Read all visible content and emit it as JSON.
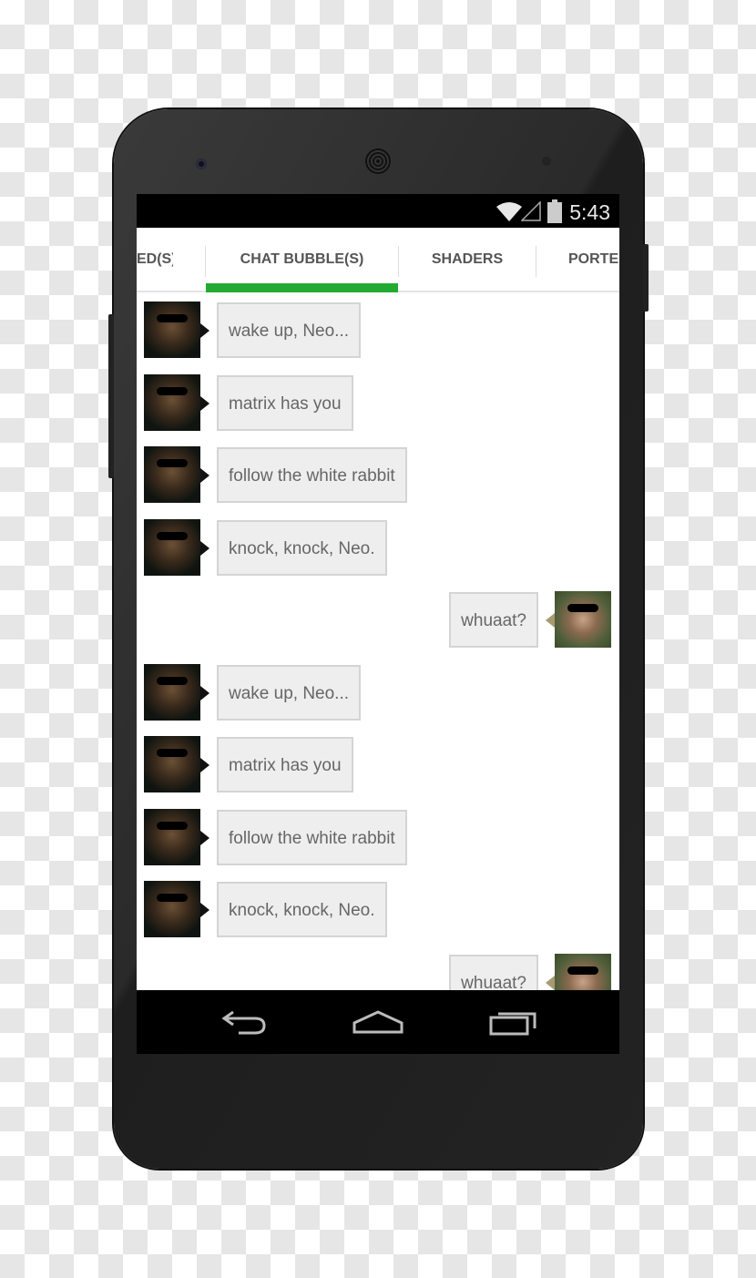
{
  "status": {
    "time": "5:43",
    "icons": [
      "wifi-icon",
      "signal-icon",
      "battery-icon"
    ]
  },
  "tabs": [
    {
      "label": "ED(S)"
    },
    {
      "label": "CHAT BUBBLE(S)",
      "active": true
    },
    {
      "label": "SHADERS"
    },
    {
      "label": "PORTE"
    }
  ],
  "accent": "#22aa33",
  "messages": [
    {
      "text": "wake up, Neo...",
      "side": "left",
      "sender": "morpheus"
    },
    {
      "text": "matrix has you",
      "side": "left",
      "sender": "morpheus"
    },
    {
      "text": "follow the white rabbit",
      "side": "left",
      "sender": "morpheus"
    },
    {
      "text": "knock, knock, Neo.",
      "side": "left",
      "sender": "morpheus"
    },
    {
      "text": "whuaat?",
      "side": "right",
      "sender": "neo"
    },
    {
      "text": "wake up, Neo...",
      "side": "left",
      "sender": "morpheus"
    },
    {
      "text": "matrix has you",
      "side": "left",
      "sender": "morpheus"
    },
    {
      "text": "follow the white rabbit",
      "side": "left",
      "sender": "morpheus"
    },
    {
      "text": "knock, knock, Neo.",
      "side": "left",
      "sender": "morpheus"
    },
    {
      "text": "whuaat?",
      "side": "right",
      "sender": "neo"
    }
  ],
  "nav": [
    "back-icon",
    "home-icon",
    "recents-icon"
  ]
}
